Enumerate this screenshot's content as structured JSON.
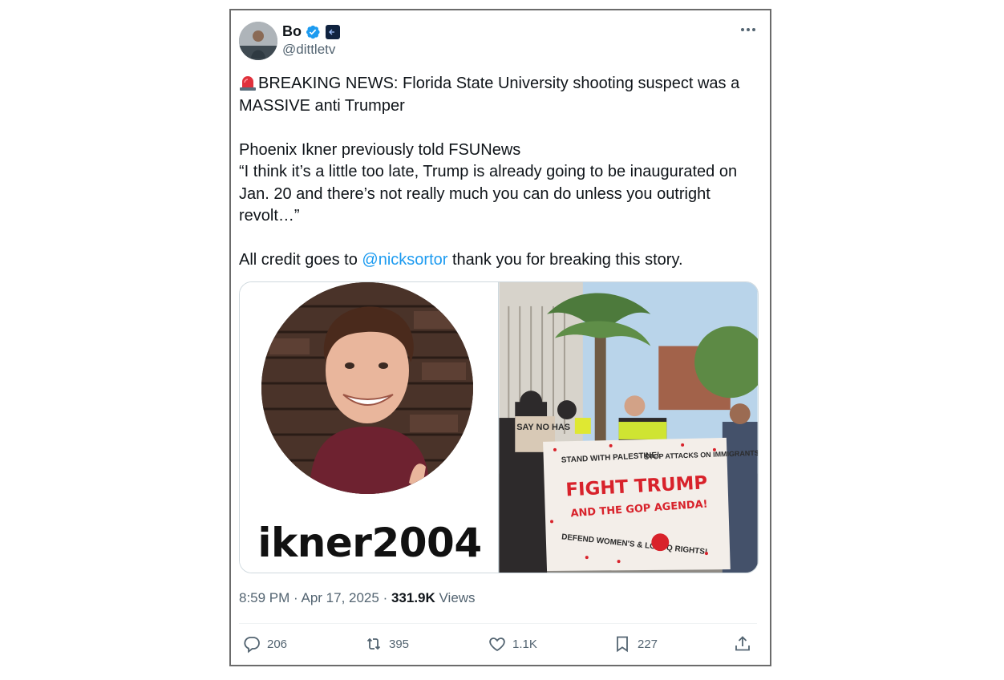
{
  "author": {
    "display_name": "Bo",
    "handle": "@dittletv"
  },
  "tweet": {
    "line1": "BREAKING NEWS: Florida State University shooting suspect was a MASSIVE anti Trumper",
    "para2_line1": "Phoenix Ikner previously told FSUNews",
    "para2_quote": "“I think it’s a little too late, Trump is already going to be inaugurated on Jan. 20 and there’s not really much you can do unless you outright revolt…”",
    "para3_prefix": "All credit goes to ",
    "para3_mention": "@nicksortor",
    "para3_suffix": " thank you for breaking this story."
  },
  "media": {
    "left_username": "ikner2004",
    "banner": {
      "sign_left": "SAY NO HAS",
      "top_left": "STAND WITH PALESTINE!",
      "top_right": "STOP ATTACKS ON IMMIGRANTS!",
      "main": "FIGHT TRUMP",
      "sub": "AND THE GOP AGENDA!",
      "bottom_left": "DEFEND WOMEN'S & LGBTQ RIGHTS!"
    }
  },
  "meta": {
    "time": "8:59 PM",
    "date": "Apr 17, 2025",
    "views_count": "331.9K",
    "views_label": "Views"
  },
  "actions": {
    "replies": "206",
    "retweets": "395",
    "likes": "1.1K",
    "bookmarks": "227"
  },
  "colors": {
    "accent": "#1d9bf0",
    "secondary_text": "#536471",
    "border": "#6b6b6b"
  }
}
